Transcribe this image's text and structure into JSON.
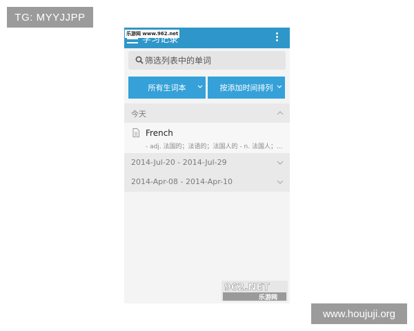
{
  "overlay": {
    "tg_label": "TG: MYYJJPP",
    "site_label": "www.houjuji.org"
  },
  "app_bar": {
    "title": "学习记录",
    "watermark": "乐游网 www.962.net",
    "menu_icon": "hamburger-menu-icon",
    "overflow_icon": "more-vert-icon",
    "color": "#2e96c9"
  },
  "search": {
    "placeholder": "筛选列表中的单词",
    "icon": "search-icon"
  },
  "filters": [
    {
      "label": "所有生词本"
    },
    {
      "label": "按添加时间排列"
    }
  ],
  "groups": [
    {
      "label": "今天",
      "expanded": true,
      "items": [
        {
          "word": "French",
          "definition": "- adj. 法国的；法语的；法国人的 - n. 法国人；..."
        }
      ]
    },
    {
      "label": "2014-Jul-20 - 2014-Jul-29",
      "expanded": false
    },
    {
      "label": "2014-Apr-08 - 2014-Apr-10",
      "expanded": false
    }
  ],
  "logo": {
    "top": "962.NET",
    "bottom": "乐游网"
  },
  "colors": {
    "accent": "#35a1d8",
    "header_bg": "#2e96c9",
    "tag_bg": "#9b9b9b"
  }
}
